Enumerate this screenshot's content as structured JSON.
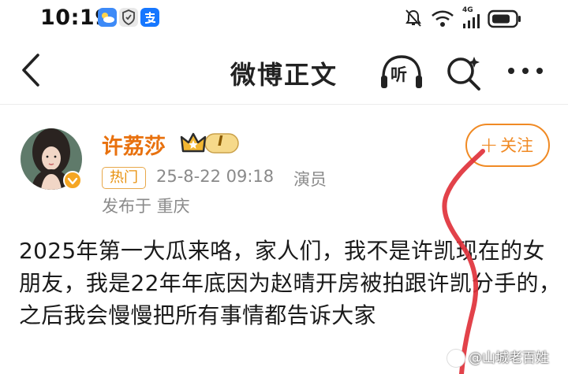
{
  "status_bar": {
    "time": "10:19",
    "network": "4G",
    "apps": [
      "weather-app-icon",
      "shield-app-icon",
      "alipay-app-icon"
    ]
  },
  "header": {
    "title": "微博正文",
    "listen_label": "听"
  },
  "post": {
    "author": {
      "name": "许荔莎",
      "vip_level": "I"
    },
    "hot_label": "热门",
    "timestamp": "25-8-22 09:18",
    "source": "演员",
    "location": "发布于 重庆",
    "follow_plus": "+",
    "follow_label": "关注",
    "text": "2025年第一大瓜来咯，家人们，我不是许凯现在的女朋友，我是22年年底因为赵晴开房被拍跟许凯分手的，之后我会慢慢把所有事情都告诉大家"
  },
  "watermark": {
    "text": "@山城老百姓"
  },
  "colors": {
    "accent": "#f08a24",
    "username": "#e8710e",
    "annotation_stroke": "#e0323b",
    "meta_text": "#8a8a8a"
  }
}
